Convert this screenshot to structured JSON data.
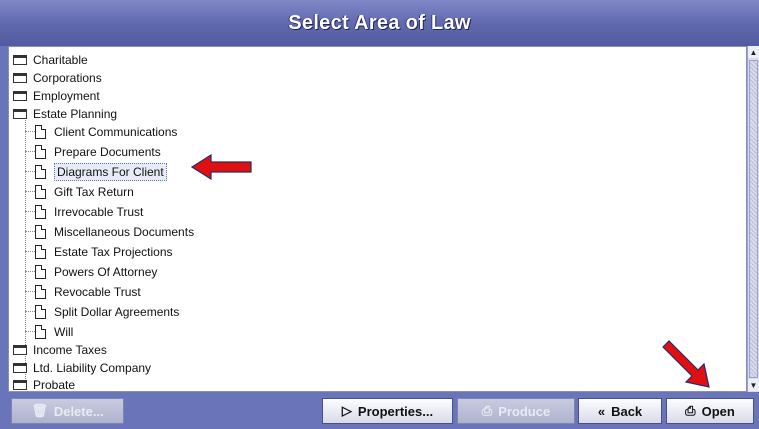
{
  "window": {
    "title": "Select Area of Law"
  },
  "tree": {
    "folders_top": [
      "Charitable",
      "Corporations",
      "Employment",
      "Estate Planning"
    ],
    "estate_planning_children": [
      "Client Communications",
      "Prepare Documents",
      "Diagrams For Client",
      "Gift Tax Return",
      "Irrevocable Trust",
      "Miscellaneous Documents",
      "Estate Tax Projections",
      "Powers Of Attorney",
      "Revocable Trust",
      "Split Dollar Agreements",
      "Will"
    ],
    "folders_bottom": [
      "Income Taxes",
      "Ltd. Liability Company",
      "Probate"
    ],
    "selected": "Diagrams For Client"
  },
  "buttons": {
    "delete": "Delete...",
    "properties": "Properties...",
    "produce": "Produce",
    "back": "Back",
    "open": "Open"
  },
  "colors": {
    "title_bar": "#5f67ad",
    "annotation_arrow": "#e01010",
    "footer": "#6a74b8"
  },
  "icons": {
    "folder": "folder-icon",
    "document": "document-icon",
    "delete": "trash-icon",
    "properties": "properties-icon",
    "produce": "printer-icon",
    "back": "back-chevron-icon",
    "open": "open-icon"
  }
}
